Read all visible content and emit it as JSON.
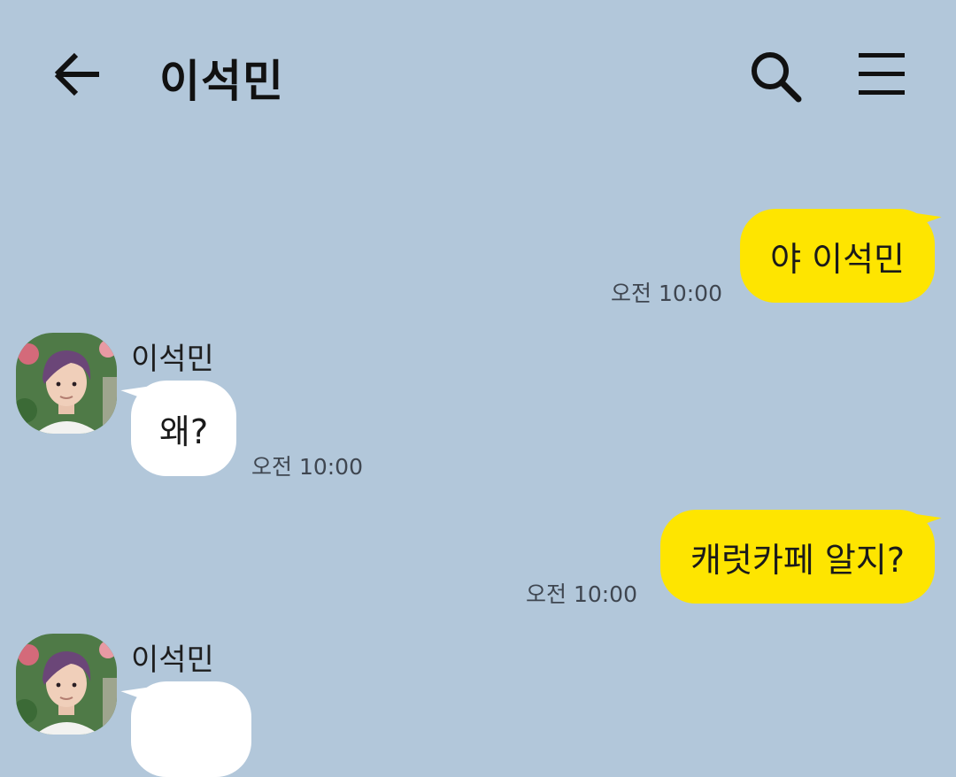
{
  "header": {
    "title": "이석민"
  },
  "messages": [
    {
      "direction": "out",
      "text": "야 이석민",
      "time": "오전 10:00"
    },
    {
      "direction": "in",
      "sender": "이석민",
      "text": "왜?",
      "time": "오전 10:00"
    },
    {
      "direction": "out",
      "text": "캐럿카페 알지?",
      "time": "오전 10:00"
    },
    {
      "direction": "in",
      "sender": "이석민",
      "text": "",
      "time": ""
    }
  ],
  "icons": {
    "back": "arrow-left-icon",
    "search": "search-icon",
    "menu": "hamburger-menu-icon",
    "avatar": "profile-photo"
  },
  "colors": {
    "background": "#b2c7da",
    "outgoing_bubble": "#fee500",
    "incoming_bubble": "#ffffff"
  }
}
